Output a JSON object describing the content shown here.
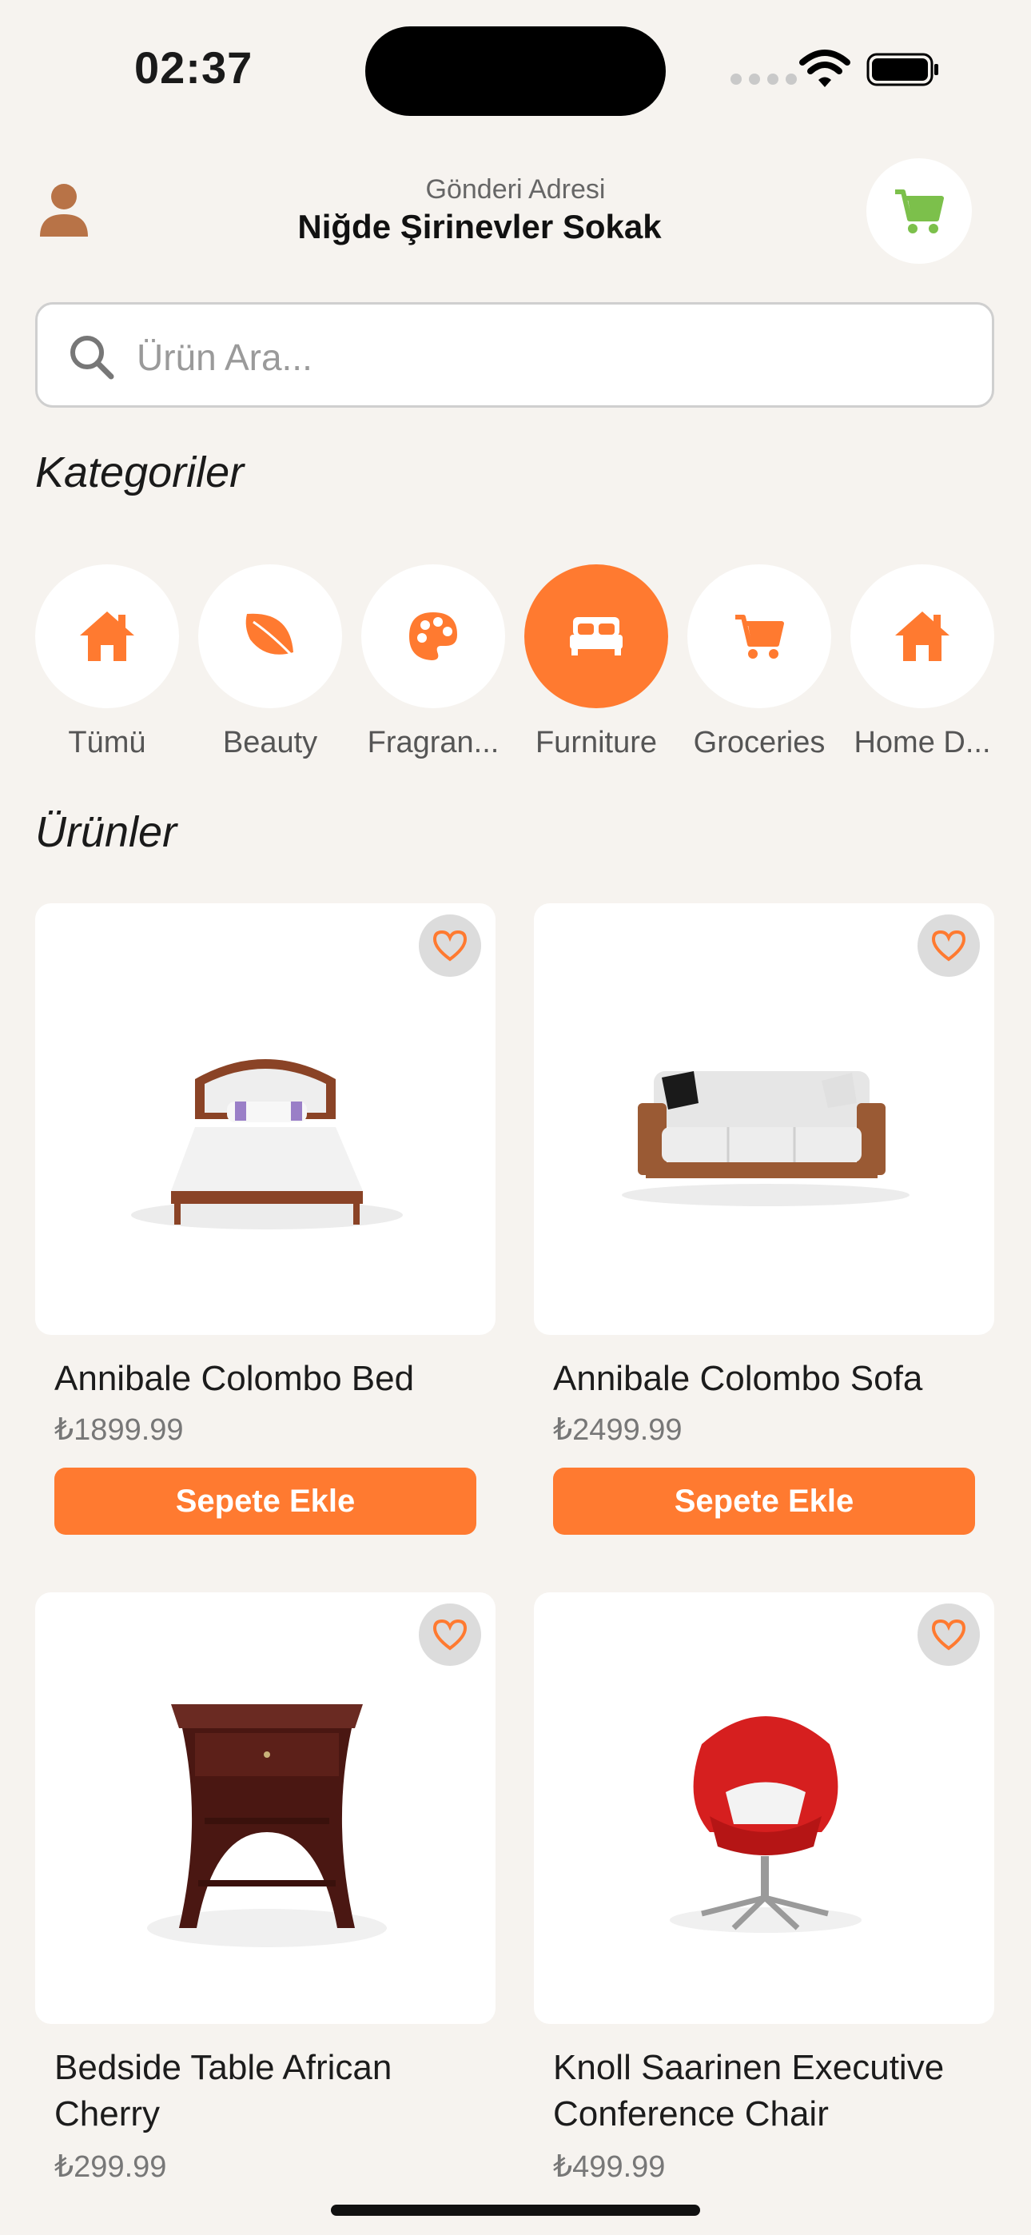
{
  "status_bar": {
    "time": "02:37"
  },
  "header": {
    "address_label": "Gönderi Adresi",
    "address_value": "Niğde Şirinevler Sokak",
    "accent_color": "#FF7A30",
    "cart_color": "#7CC04B",
    "profile_color": "#B87347"
  },
  "search": {
    "placeholder": "Ürün Ara...",
    "value": ""
  },
  "categories_title": "Kategoriler",
  "categories": [
    {
      "label": "Tümü",
      "icon": "home-icon",
      "active": false
    },
    {
      "label": "Beauty",
      "icon": "leaf-icon",
      "active": false
    },
    {
      "label": "Fragran...",
      "icon": "palette-icon",
      "active": false
    },
    {
      "label": "Furniture",
      "icon": "bed-icon",
      "active": true
    },
    {
      "label": "Groceries",
      "icon": "cart-icon",
      "active": false
    },
    {
      "label": "Home D...",
      "icon": "home-icon",
      "active": false
    }
  ],
  "products_title": "Ürünler",
  "products": [
    {
      "name": "Annibale Colombo Bed",
      "price": "₺1899.99",
      "button": "Sepete Ekle"
    },
    {
      "name": "Annibale Colombo Sofa",
      "price": "₺2499.99",
      "button": "Sepete Ekle"
    },
    {
      "name": "Bedside Table African Cherry",
      "price": "₺299.99"
    },
    {
      "name": "Knoll Saarinen Executive Conference Chair",
      "price": "₺499.99"
    }
  ]
}
